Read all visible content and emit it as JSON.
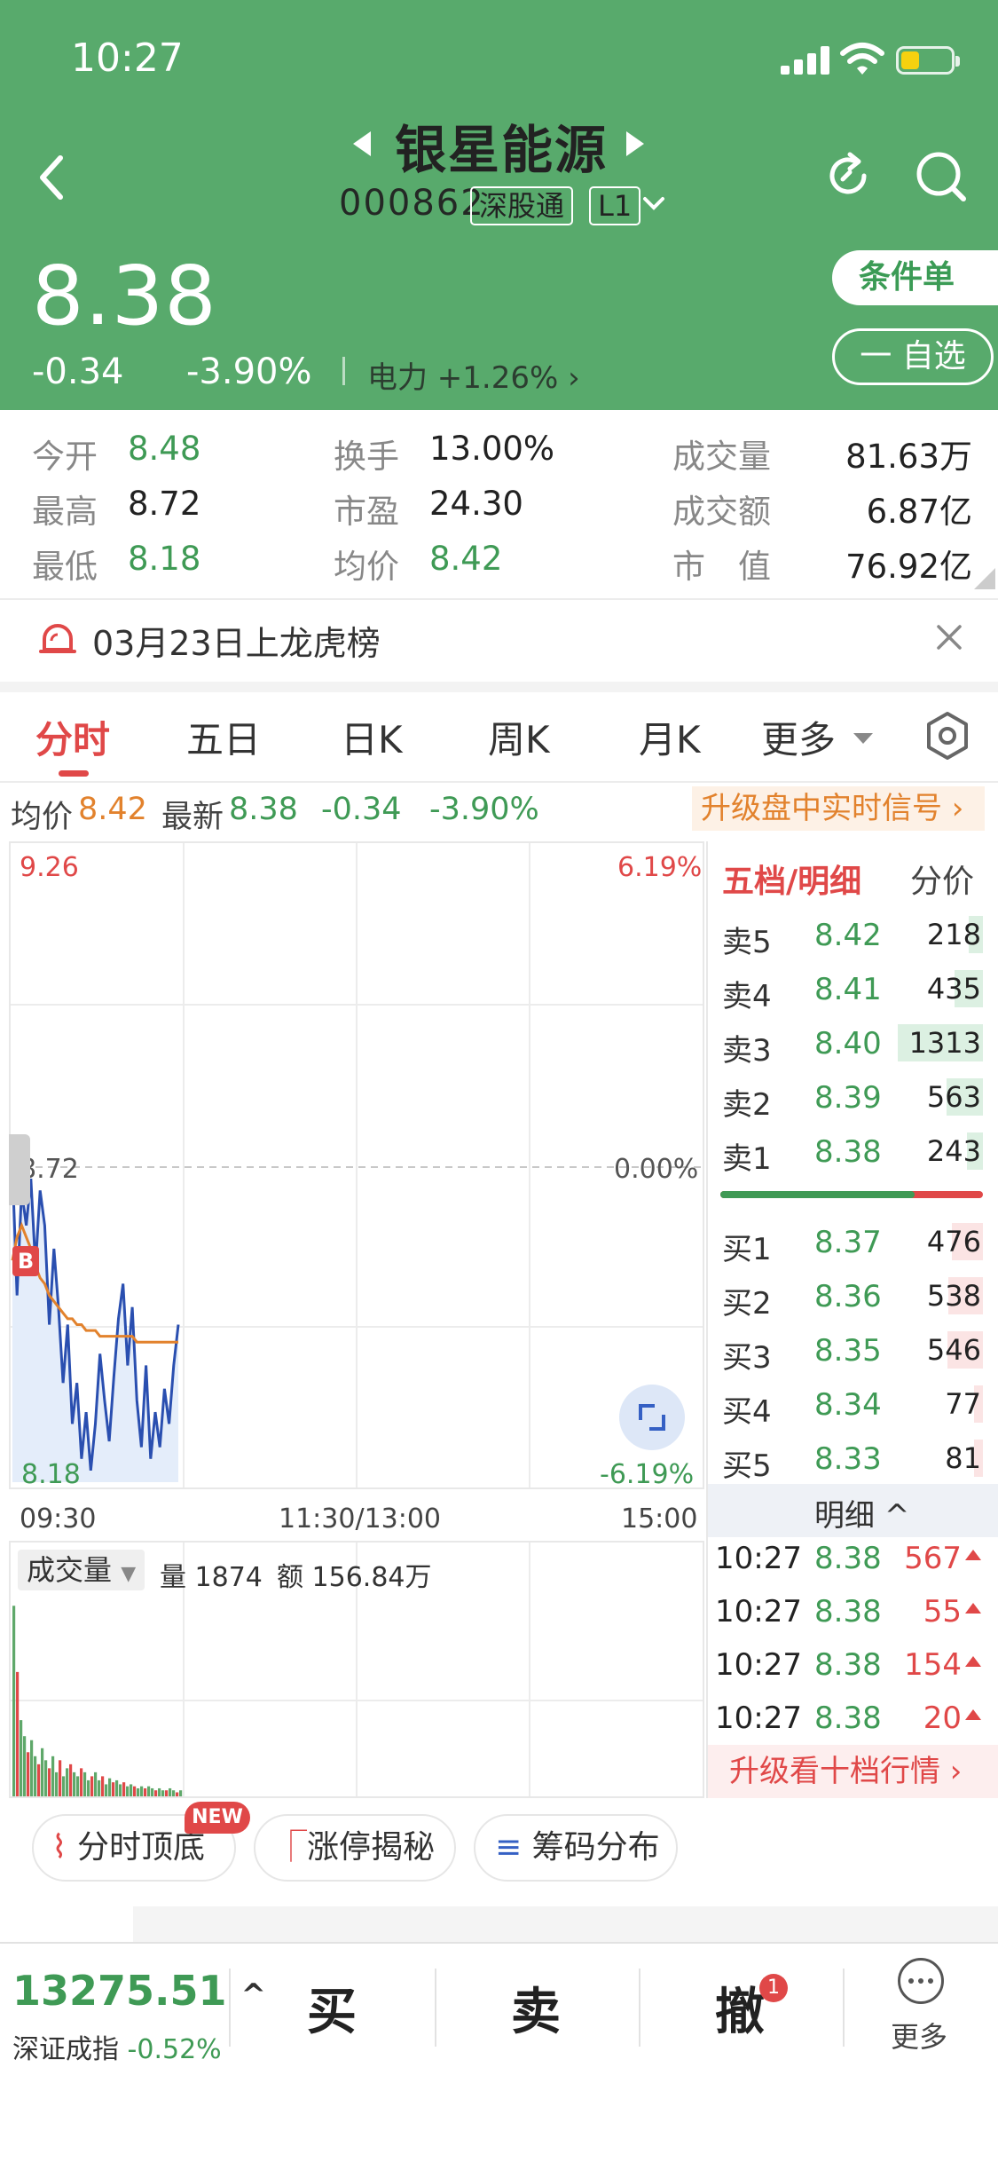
{
  "status_bar": {
    "time": "10:27"
  },
  "header": {
    "stock_name": "银星能源",
    "code": "000862",
    "tag_connect": "深股通",
    "tag_level": "L1",
    "price": "8.38",
    "change": "-0.34",
    "change_pct": "-3.90%",
    "sector": "电力 +1.26%",
    "conditional_order": "条件单",
    "add_watch": "一 自选"
  },
  "stats": {
    "open_label": "今开",
    "open_value": "8.48",
    "high_label": "最高",
    "high_value": "8.72",
    "low_label": "最低",
    "low_value": "8.18",
    "turnover_label": "换手",
    "turnover_value": "13.00%",
    "pe_label": "市盈",
    "pe_value": "24.30",
    "avg_label": "均价",
    "avg_value": "8.42",
    "volume_label": "成交量",
    "volume_value": "81.63万",
    "amount_label": "成交额",
    "amount_value": "6.87亿",
    "mcap_label": "市　值",
    "mcap_value": "76.92亿"
  },
  "notice": {
    "text": "03月23日上龙虎榜"
  },
  "tabs": [
    "分时",
    "五日",
    "日K",
    "周K",
    "月K",
    "更多"
  ],
  "infoline": {
    "avg_label": "均价",
    "avg_value": "8.42",
    "latest_label": "最新",
    "latest_value": "8.38",
    "chg": "-0.34",
    "pct": "-3.90%",
    "upgrade": "升级盘中实时信号"
  },
  "chart": {
    "y_top": "9.26",
    "y_mid": "8.72",
    "y_bot": "8.18",
    "pct_top": "6.19%",
    "pct_mid": "0.00%",
    "pct_bot": "-6.19%",
    "x_start": "09:30",
    "x_mid": "11:30/13:00",
    "x_end": "15:00",
    "buy_marker": "B"
  },
  "chart_data": {
    "type": "line",
    "series": [
      {
        "name": "price",
        "values": [
          8.72,
          8.5,
          8.68,
          8.62,
          8.7,
          8.55,
          8.68,
          8.62,
          8.45,
          8.58,
          8.48,
          8.35,
          8.45,
          8.28,
          8.35,
          8.22,
          8.3,
          8.2,
          8.28,
          8.4,
          8.32,
          8.25,
          8.36,
          8.46,
          8.52,
          8.38,
          8.48,
          8.32,
          8.24,
          8.38,
          8.22,
          8.3,
          8.24,
          8.34,
          8.28,
          8.38,
          8.45
        ]
      },
      {
        "name": "avg",
        "values": [
          8.56,
          8.6,
          8.62,
          8.6,
          8.58,
          8.55,
          8.53,
          8.52,
          8.5,
          8.49,
          8.48,
          8.47,
          8.46,
          8.46,
          8.45,
          8.45,
          8.44,
          8.44,
          8.44,
          8.43,
          8.43,
          8.43,
          8.43,
          8.43,
          8.43,
          8.43,
          8.43,
          8.42,
          8.42,
          8.42,
          8.42,
          8.42,
          8.42,
          8.42,
          8.42,
          8.42,
          8.42
        ]
      }
    ],
    "ylim": [
      8.18,
      9.26
    ],
    "prev_close": 8.72
  },
  "volume": {
    "label": "成交量",
    "qty": "量 1874",
    "amt": "额 156.84万",
    "bars": [
      0.95,
      0.62,
      0.38,
      0.3,
      0.22,
      0.28,
      0.2,
      0.16,
      0.24,
      0.18,
      0.14,
      0.2,
      0.12,
      0.18,
      0.1,
      0.14,
      0.16,
      0.12,
      0.1,
      0.14,
      0.12,
      0.08,
      0.1,
      0.12,
      0.08,
      0.1,
      0.06,
      0.09,
      0.07,
      0.08,
      0.06,
      0.07,
      0.05,
      0.06,
      0.05,
      0.04,
      0.05,
      0.04,
      0.05,
      0.04,
      0.03,
      0.04,
      0.03,
      0.03,
      0.04,
      0.03,
      0.02,
      0.03
    ]
  },
  "orderbook": {
    "title": "五档/明细",
    "alt": "分价",
    "asks": [
      {
        "label": "卖5",
        "price": "8.42",
        "vol": "218",
        "ratio": 0.17
      },
      {
        "label": "卖4",
        "price": "8.41",
        "vol": "435",
        "ratio": 0.33
      },
      {
        "label": "卖3",
        "price": "8.40",
        "vol": "1313",
        "ratio": 1.0
      },
      {
        "label": "卖2",
        "price": "8.39",
        "vol": "563",
        "ratio": 0.43
      },
      {
        "label": "卖1",
        "price": "8.38",
        "vol": "243",
        "ratio": 0.19
      }
    ],
    "bids": [
      {
        "label": "买1",
        "price": "8.37",
        "vol": "476",
        "ratio": 0.36
      },
      {
        "label": "买2",
        "price": "8.36",
        "vol": "538",
        "ratio": 0.41
      },
      {
        "label": "买3",
        "price": "8.35",
        "vol": "546",
        "ratio": 0.42
      },
      {
        "label": "买4",
        "price": "8.34",
        "vol": "77",
        "ratio": 0.06
      },
      {
        "label": "买5",
        "price": "8.33",
        "vol": "81",
        "ratio": 0.06
      }
    ],
    "buy_ratio": 0.74,
    "detail_title": "明细",
    "ticks": [
      {
        "time": "10:27",
        "price": "8.38",
        "vol": "567"
      },
      {
        "time": "10:27",
        "price": "8.38",
        "vol": "55"
      },
      {
        "time": "10:27",
        "price": "8.38",
        "vol": "154"
      },
      {
        "time": "10:27",
        "price": "8.38",
        "vol": "20"
      }
    ],
    "upgrade": "升级看十档行情"
  },
  "features": {
    "btn1": "分时顶底",
    "btn2": "涨停揭秘",
    "btn3": "筹码分布",
    "new_badge": "NEW"
  },
  "bottom": {
    "index_value": "13275.51",
    "index_name": "深证成指",
    "index_pct": "-0.52%",
    "buy": "买",
    "sell": "卖",
    "cancel": "撤",
    "cancel_badge": "1",
    "more": "更多"
  },
  "colors": {
    "header_green": "#58aa6c",
    "up_red": "#e04848",
    "down_green": "#3f9a55",
    "avg_orange": "#e2822d",
    "price_blue": "#2a4fb0"
  }
}
